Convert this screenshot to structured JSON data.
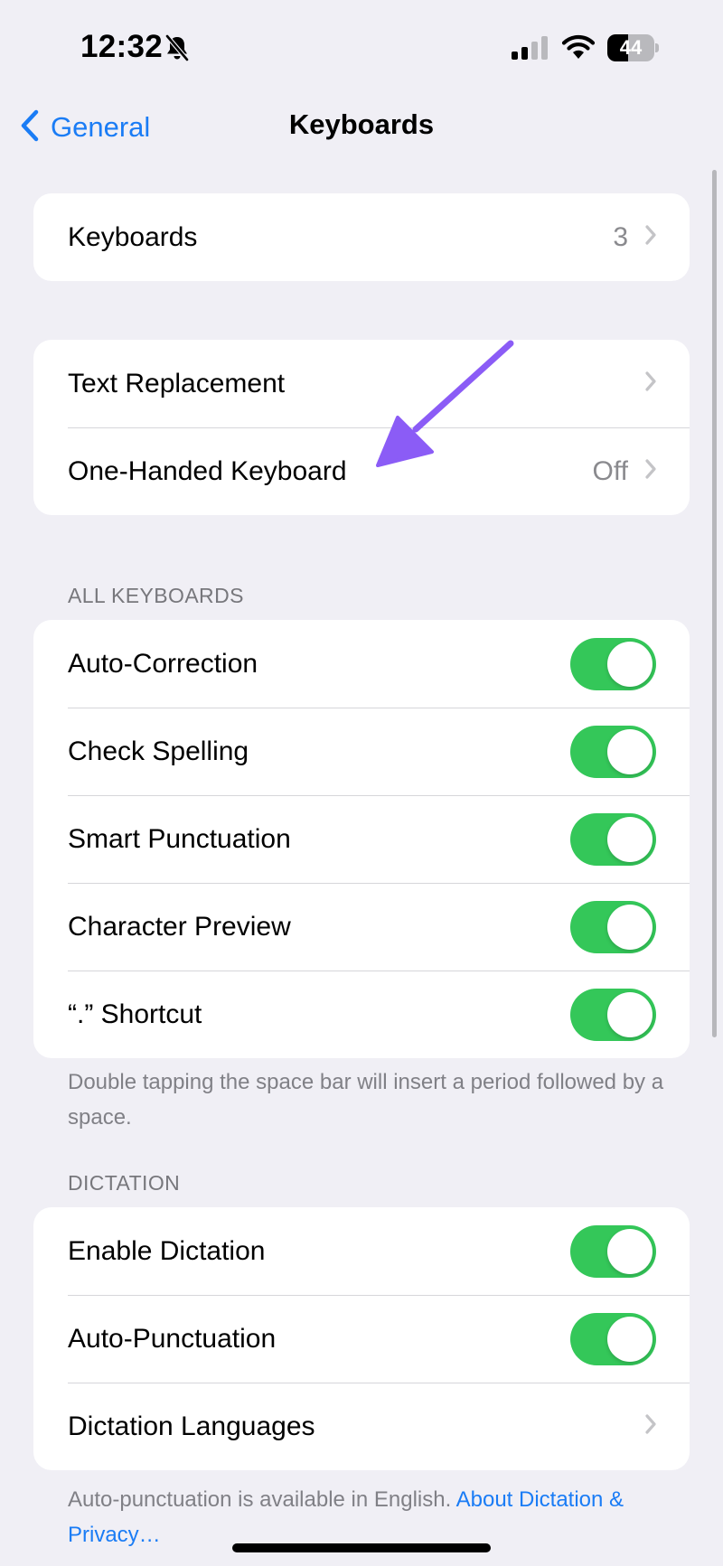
{
  "status_bar": {
    "time": "12:32",
    "battery_level": "44",
    "battery_fraction": 0.44,
    "icons": [
      "bell-slash-icon",
      "cellular-signal-icon",
      "wifi-icon",
      "battery-icon"
    ]
  },
  "nav": {
    "back_label": "General",
    "title": "Keyboards"
  },
  "group_keyboards": {
    "rows": [
      {
        "label": "Keyboards",
        "value": "3"
      }
    ]
  },
  "group_options": {
    "rows": [
      {
        "label": "Text Replacement"
      },
      {
        "label": "One-Handed Keyboard",
        "value": "Off"
      }
    ]
  },
  "all_keyboards": {
    "header": "ALL KEYBOARDS",
    "rows": [
      {
        "label": "Auto-Correction",
        "on": true
      },
      {
        "label": "Check Spelling",
        "on": true
      },
      {
        "label": "Smart Punctuation",
        "on": true
      },
      {
        "label": "Character Preview",
        "on": true
      },
      {
        "label": "“.” Shortcut",
        "on": true
      }
    ],
    "footer": "Double tapping the space bar will insert a period followed by a space."
  },
  "dictation": {
    "header": "DICTATION",
    "rows": [
      {
        "label": "Enable Dictation",
        "on": true
      },
      {
        "label": "Auto-Punctuation",
        "on": true
      },
      {
        "label": "Dictation Languages"
      }
    ],
    "footer_text": "Auto-punctuation is available in English. ",
    "footer_link": "About Dictation & Privacy…"
  },
  "colors": {
    "accent": "#1a7cf5",
    "toggle_on": "#34c759",
    "annotation_arrow": "#8b5cf6",
    "background": "#f0eff5"
  }
}
